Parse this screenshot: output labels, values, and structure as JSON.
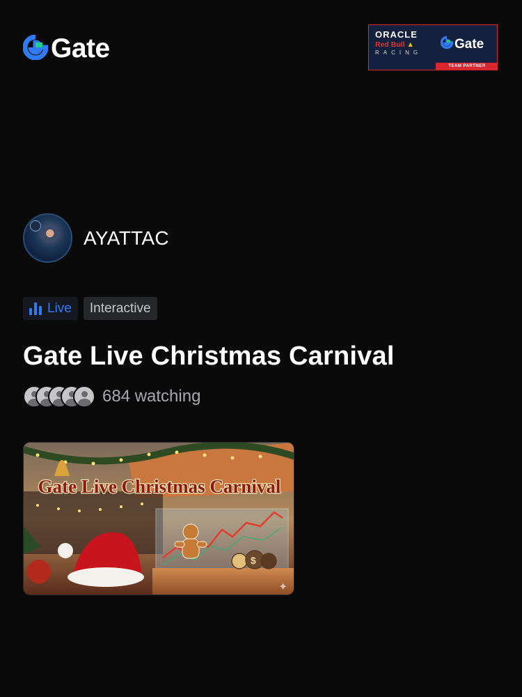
{
  "brand": {
    "logo_text": "Gate",
    "logo_icon": "gate-logo-icon",
    "accent_color": "#2f7bf4",
    "partner": {
      "oracle": "ORACLE",
      "redbull": "Red Bull",
      "racing": "RACING",
      "gate": "Gate",
      "strip": "TEAM PARTNER"
    }
  },
  "host": {
    "name": "AYATTAC",
    "avatar_icon": "host-avatar"
  },
  "tags": {
    "live_label": "Live",
    "live_icon": "live-bars-icon",
    "interactive_label": "Interactive"
  },
  "stream": {
    "title": "Gate Live Christmas Carnival",
    "viewers": "684 watching",
    "cover_title": "Gate Live Christmas Carnival"
  }
}
